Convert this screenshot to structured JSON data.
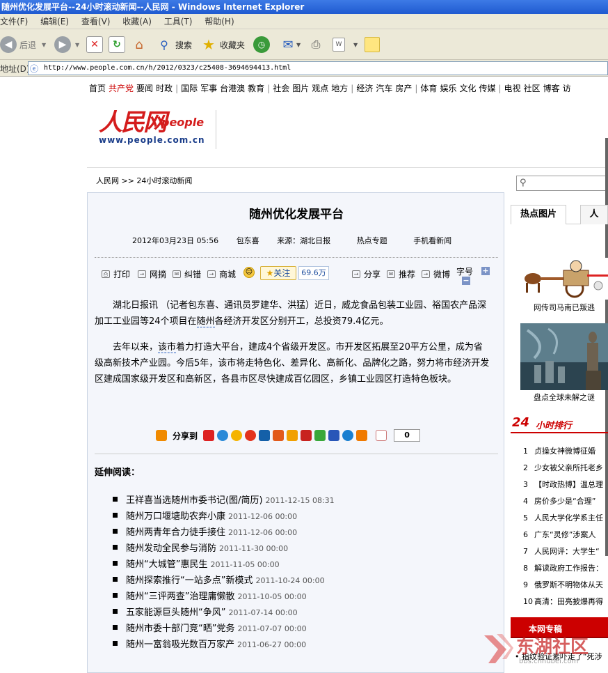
{
  "window": {
    "title": "随州优化发展平台--24小时滚动新闻--人民网 - Windows Internet Explorer"
  },
  "menu": [
    "文件(F)",
    "编辑(E)",
    "查看(V)",
    "收藏(A)",
    "工具(T)",
    "帮助(H)"
  ],
  "toolbar": {
    "back": "后退",
    "search": "搜索",
    "favorites": "收藏夹"
  },
  "address": {
    "label": "地址(D)",
    "url": "http://www.people.com.cn/h/2012/0323/c25408-3694694413.html"
  },
  "sitenav": [
    "首页",
    "共产党",
    "要闻",
    "时政",
    "|",
    "国际",
    "军事",
    "台港澳",
    "教育",
    "|",
    "社会",
    "图片",
    "观点",
    "地方",
    "|",
    "经济",
    "汽车",
    "房产",
    "|",
    "体育",
    "娱乐",
    "文化",
    "传媒",
    "|",
    "电视",
    "社区",
    "博客",
    "访"
  ],
  "logo": {
    "cn": "人民网",
    "en": "people",
    "url": "www.people.com.cn"
  },
  "breadcrumb": "人民网 >> 24小时滚动新闻",
  "article": {
    "title": "随州优化发展平台",
    "date": "2012年03月23日  05:56",
    "author": "包东喜",
    "source": "来源：湖北日报",
    "hot": "热点专题",
    "mobile": "手机看新闻",
    "tools": {
      "print": "打印",
      "collect": "网摘",
      "correct": "纠错",
      "mall": "商城",
      "follow": "关注",
      "follow_count": "69.6万",
      "share": "分享",
      "recommend": "推荐",
      "weibo": "微博",
      "fontsize": "字号"
    },
    "p1_a": "湖北日报讯  （记者包东喜、通讯员罗建华、洪猛）近日，威龙食品包装工业园、裕国农产品深加工工业园等24个项目在",
    "p1_kw": "随州",
    "p1_b": "各经济开发区分别开工，总投资79.4亿元。",
    "p2_a": "去年以来，",
    "p2_kw": "该市",
    "p2_b": "着力打造大平台，建成4个省级开发区。市开发区拓展至20平方公里，成为省级高新技术产业园。今后5年，该市将走特色化、差异化、高新化、品牌化之路，努力将市经济开发区建成国家级开发区和高新区，各县市区尽快建成百亿园区，乡镇工业园区打造特色板块。",
    "share_label": "分享到",
    "share_count": "0",
    "related_title": "延伸阅读：",
    "related": [
      {
        "t": "王祥喜当选随州市委书记(图/简历)",
        "d": "2011-12-15 08:31"
      },
      {
        "t": "随州万口堰塘助农奔小康",
        "d": "2011-12-06 00:00"
      },
      {
        "t": "随州两青年合力徒手接住",
        "d": "2011-12-06 00:00"
      },
      {
        "t": "随州发动全民参与消防",
        "d": "2011-11-30 00:00"
      },
      {
        "t": "随州“大城管”惠民生",
        "d": "2011-11-05 00:00"
      },
      {
        "t": "随州探索推行“一站多点”新模式",
        "d": "2011-10-24 00:00"
      },
      {
        "t": "随州“三评两查”治理庸懒散",
        "d": "2011-10-05 00:00"
      },
      {
        "t": "五家能源巨头随州“争风”",
        "d": "2011-07-14 00:00"
      },
      {
        "t": "随州市委十部门竞“晒”党务",
        "d": "2011-07-07 00:00"
      },
      {
        "t": "随州一富翁吸光数百万家产",
        "d": "2011-06-27 00:00"
      }
    ]
  },
  "right": {
    "tab1": "热点图片",
    "tab2": "人",
    "pic1_caption": "网传司马南已叛逃",
    "pic2_caption": "盘点全球未解之谜",
    "rank_num": "24",
    "rank_title": "小时排行",
    "ranks": [
      "贞操女神微博征婚",
      "少女被父亲所托老乡",
      "【时政热博】温总理",
      "房价多少是“合理”",
      "人民大学化学系主任",
      "广东“灵修”涉案人",
      "人民网评：大学生“",
      "解读政府工作报告：",
      "俄罗斯不明物体从天",
      "高清：田亮披爆再得"
    ],
    "special": "本网专稿",
    "bottom": "• 指纹验证素吓走了“死涉"
  },
  "watermark": {
    "text": "东湖社区",
    "sub": "bbs.cnhubei.com"
  }
}
